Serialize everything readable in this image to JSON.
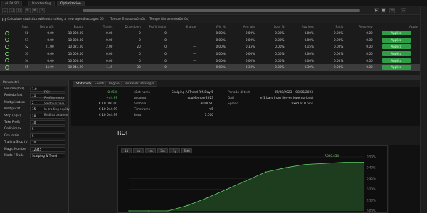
{
  "tabs": [
    {
      "label": "AUDUSD",
      "active": false
    },
    {
      "label": "Backtesting",
      "active": false
    },
    {
      "label": "Optimization",
      "active": true
    }
  ],
  "toolbar": {
    "buttons": [
      "▢",
      "▢",
      "▢",
      "✎",
      "≡",
      "↺",
      "▶",
      "■",
      "⇆",
      "⋯"
    ],
    "progress_pct": 100
  },
  "infobar": {
    "checkbox_label": "Calculate statistics without making a new agent",
    "passes_label": "Passages",
    "passes_value": "60",
    "time_label_1": "Tempo Trascorso",
    "time_value_1": "0m0s",
    "time_label_2": "Tempo Rimanente",
    "time_value_2": "(0m0s)"
  },
  "table": {
    "headers": [
      "",
      "Pass",
      "Net profit",
      "Equity",
      "Trades",
      "Drawdown",
      "Profit factor",
      "Sharpe",
      "Win %",
      "Avg win",
      "Loss %",
      "Avg loss",
      "Ratio",
      "Recovery",
      "Apply"
    ],
    "rows": [
      {
        "cells": [
          "50",
          "0.00",
          "10 000.00",
          "0.00",
          "0",
          "0",
          "—",
          "0.00%",
          "0.00%",
          "0.00%",
          "0.00%",
          "0.00%",
          "0.00"
        ],
        "apply": "Applica",
        "selected": false
      },
      {
        "cells": [
          "51",
          "0.00",
          "10 000.00",
          "0.00",
          "0",
          "0",
          "—",
          "0.00%",
          "0.00%",
          "0.00%",
          "0.00%",
          "0.00%",
          "0.00"
        ],
        "apply": "Applica",
        "selected": false
      },
      {
        "cells": [
          "52",
          "21.00",
          "10 021.00",
          "2.00",
          "20",
          "0",
          "—",
          "0.00%",
          "0.15%",
          "0.00%",
          "0.15%",
          "0.00%",
          "0.00"
        ],
        "apply": "Applica",
        "selected": false
      },
      {
        "cells": [
          "53",
          "0.00",
          "10 000.00",
          "0.00",
          "0",
          "0",
          "—",
          "0.00%",
          "0.00%",
          "0.00%",
          "0.00%",
          "0.00%",
          "0.00"
        ],
        "apply": "Applica",
        "selected": false
      },
      {
        "cells": [
          "54",
          "0.00",
          "10 000.00",
          "0.00",
          "0",
          "0",
          "—",
          "0.00%",
          "0.00%",
          "0.00%",
          "0.00%",
          "0.00%",
          "0.00"
        ],
        "apply": "Applica",
        "selected": false
      },
      {
        "cells": [
          "55",
          "44.99",
          "10 044.99",
          "1.49",
          "30",
          "0",
          "—",
          "0.00%",
          "0.30%",
          "0.00%",
          "0.30%",
          "0.00%",
          "0.00"
        ],
        "apply": "Applica",
        "selected": true
      }
    ]
  },
  "params": {
    "title": "Parametri",
    "items": [
      {
        "label": "Volume (lots)",
        "value": "1.0"
      },
      {
        "label": "Periodo fast",
        "value": "11"
      },
      {
        "label": "Moltiplicatore",
        "value": "2"
      },
      {
        "label": "Moltiplicat.",
        "value": "15"
      },
      {
        "label": "Stop (pips)",
        "value": "10"
      },
      {
        "label": "Take Profit",
        "value": "10"
      },
      {
        "label": "Ordini max",
        "value": "5"
      },
      {
        "label": "Ora inizio",
        "value": "5"
      },
      {
        "label": "Trailing Stop (p)",
        "value": "10"
      },
      {
        "label": "Magic Number",
        "value": "12345"
      },
      {
        "label": "Modo / Trade",
        "value": "Scalping & Trend"
      }
    ]
  },
  "rtabs": [
    {
      "label": "Statistiche",
      "active": true
    },
    {
      "label": "Eventi",
      "active": false
    },
    {
      "label": "Regole",
      "active": false
    },
    {
      "label": "Parametri strategia",
      "active": false
    }
  ],
  "stats": {
    "col1": [
      {
        "k": "ROI",
        "v": "0.45%",
        "green": true
      },
      {
        "k": "Profitto netto",
        "v": "+44.99",
        "green": true
      },
      {
        "k": "Saldo iniziale",
        "v": "€ 10 000.00",
        "green": false
      },
      {
        "k": "In trading equity",
        "v": "€ 10 044.99",
        "green": false
      },
      {
        "k": "Ending balance",
        "v": "€ 10 044.99",
        "green": false
      }
    ],
    "col2": [
      {
        "k": "cBot name",
        "v": "Scalping Al Trend Rif. Day 5"
      },
      {
        "k": "Account",
        "v": "cuuMember2023"
      },
      {
        "k": "Simbolo",
        "v": "AUDUSD"
      },
      {
        "k": "Timeframe",
        "v": "m5"
      },
      {
        "k": "Leva",
        "v": "1:500"
      }
    ],
    "col3": [
      {
        "k": "Periodo di test",
        "v": "05/08/2023 – 08/08/2023"
      },
      {
        "k": "Dati",
        "v": "m1 bars from Server (open prices)"
      },
      {
        "k": "Spread",
        "v": "fixed at 0 pips"
      }
    ]
  },
  "roi": {
    "title": "ROI",
    "range_buttons": [
      "1d",
      "1w",
      "1m",
      "3m",
      "1y",
      "Tutti"
    ],
    "tooltip": "ROI 0.45%"
  },
  "chart_data": {
    "type": "area",
    "title": "ROI",
    "x_index": [
      0,
      1,
      2,
      3,
      4,
      5,
      6,
      7,
      8,
      9,
      10,
      11,
      12
    ],
    "values": [
      0.0,
      0.0,
      0.0,
      0.05,
      0.12,
      0.2,
      0.28,
      0.36,
      0.4,
      0.43,
      0.44,
      0.45,
      0.45
    ],
    "ylim": [
      0.0,
      0.5
    ],
    "y_ticks": [
      "0.50%",
      "0.40%",
      "0.30%",
      "0.20%",
      "0.10%",
      "0.00%"
    ],
    "colors": {
      "line": "#5fd36a",
      "fill": "#1e3d1e"
    }
  }
}
